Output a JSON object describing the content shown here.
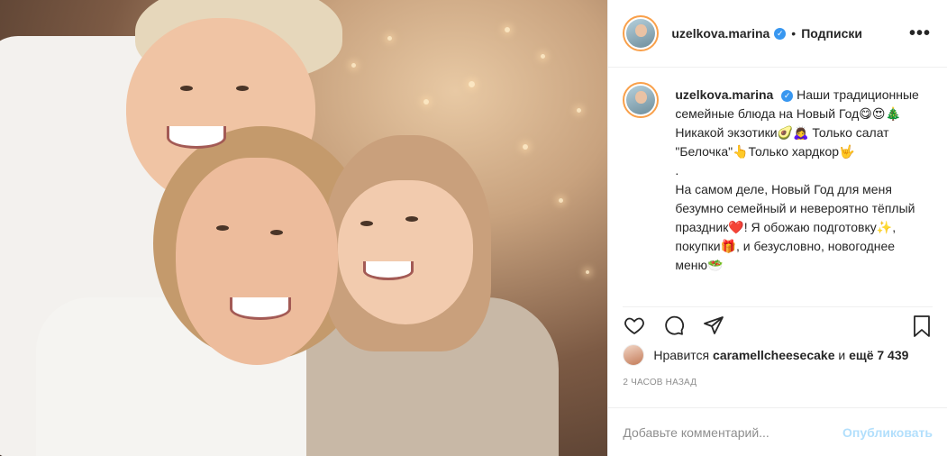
{
  "post": {
    "username": "uzelkova.marina",
    "separator": "•",
    "follow_label": "Подписки",
    "more_icon": "more-options-icon",
    "caption": {
      "username": "uzelkova.marina",
      "line1": "Наши традиционные семейные блюда на Новый Год😋😍🎄Никакой экзотики🥑🙇‍♀️ Только салат \"Белочка\"👆Только хардкор🤟",
      "line2": ".",
      "line3": "На самом деле, Новый Год для меня безумно семейный и невероятно тёплый праздник❤️! Я обожаю подготовку✨, покупки🎁, и безусловно, новогоднее меню🥗"
    },
    "actions": {
      "like_icon": "heart-icon",
      "comment_icon": "comment-icon",
      "share_icon": "share-icon",
      "save_icon": "bookmark-icon"
    },
    "likes": {
      "prefix": "Нравится",
      "user": "caramellcheesecake",
      "middle": "и",
      "count": "ещё 7 439"
    },
    "timestamp": "2 ЧАСОВ НАЗАД",
    "comment": {
      "placeholder": "Добавьте комментарий...",
      "publish_label": "Опубликовать"
    },
    "colors": {
      "accent": "#3897f0",
      "publish_disabled": "#b2dffc",
      "muted": "#8e8e8e",
      "text": "#262626"
    }
  }
}
